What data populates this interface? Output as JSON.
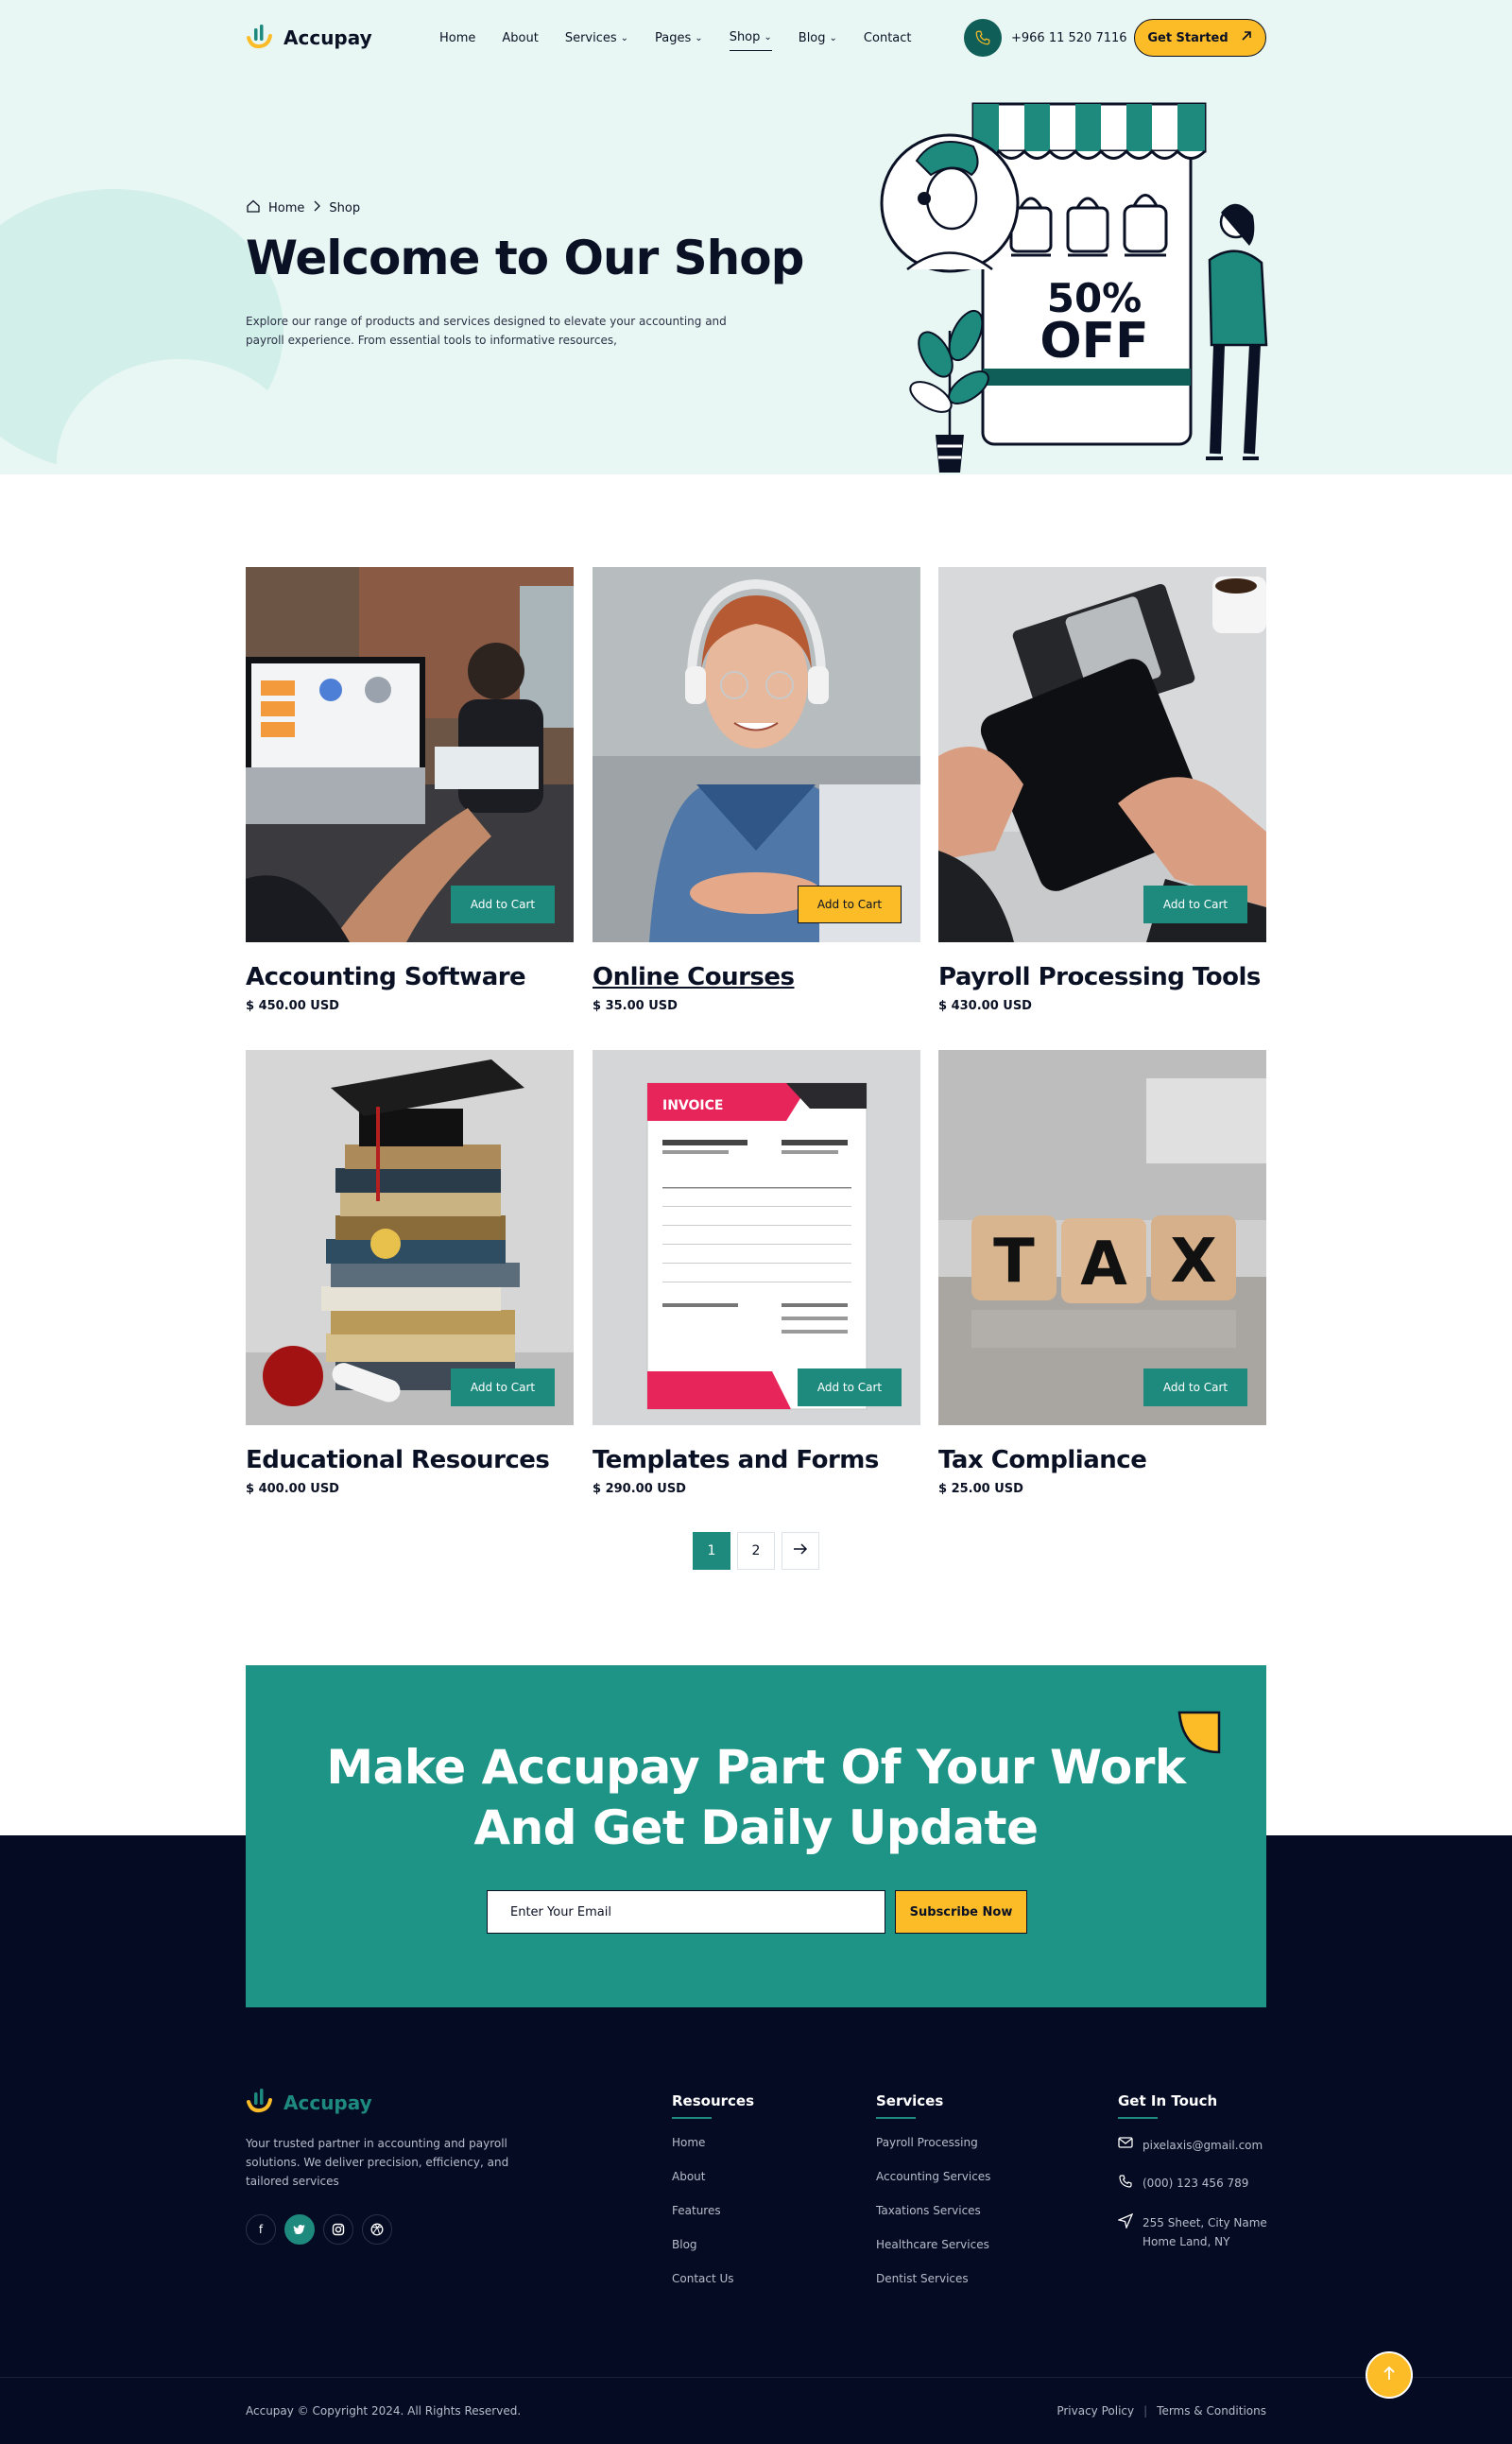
{
  "brand": {
    "name": "Accupay"
  },
  "nav": {
    "items": [
      {
        "label": "Home",
        "dropdown": false
      },
      {
        "label": "About",
        "dropdown": false
      },
      {
        "label": "Services",
        "dropdown": true
      },
      {
        "label": "Pages",
        "dropdown": true
      },
      {
        "label": "Shop",
        "dropdown": true,
        "active": true
      },
      {
        "label": "Blog",
        "dropdown": true
      },
      {
        "label": "Contact",
        "dropdown": false
      }
    ],
    "phone": "+966 11 520 7116",
    "cta_label": "Get Started"
  },
  "hero": {
    "breadcrumb": {
      "home": "Home",
      "current": "Shop"
    },
    "title": "Welcome to Our Shop",
    "description": "Explore our range of products and services designed to elevate your accounting and payroll experience. From essential tools to informative resources,",
    "sale_line1": "50%",
    "sale_line2": "OFF"
  },
  "products": [
    {
      "title": "Accounting Software",
      "price": "$ 450.00 USD",
      "button": "Add to Cart"
    },
    {
      "title": "Online Courses",
      "price": "$ 35.00 USD",
      "button": "Add to Cart"
    },
    {
      "title": "Payroll Processing Tools",
      "price": "$ 430.00 USD",
      "button": "Add to Cart"
    },
    {
      "title": "Educational Resources",
      "price": "$ 400.00 USD",
      "button": "Add to Cart"
    },
    {
      "title": "Templates and Forms",
      "price": "$ 290.00 USD",
      "button": "Add to Cart"
    },
    {
      "title": "Tax Compliance",
      "price": "$ 25.00 USD",
      "button": "Add to Cart"
    }
  ],
  "pagination": {
    "pages": [
      "1",
      "2"
    ],
    "current": "1"
  },
  "invoice_label": "INVOICE",
  "tax_letters": [
    "T",
    "A",
    "X"
  ],
  "cta": {
    "title_line1": "Make Accupay Part Of Your Work",
    "title_line2": "And Get Daily Update",
    "placeholder": "Enter Your Email",
    "button": "Subscribe Now"
  },
  "footer": {
    "about": "Your trusted partner in accounting and payroll solutions. We deliver precision, efficiency, and tailored services",
    "socials": [
      "f",
      "t",
      "i",
      "d"
    ],
    "resources": {
      "title": "Resources",
      "links": [
        "Home",
        "About",
        "Features",
        "Blog",
        "Contact Us"
      ]
    },
    "services": {
      "title": "Services",
      "links": [
        "Payroll Processing",
        "Accounting Services",
        "Taxations Services",
        "Healthcare Services",
        "Dentist Services"
      ]
    },
    "contact": {
      "title": "Get In Touch",
      "email": "pixelaxis@gmail.com",
      "phone": "(000) 123 456 789",
      "address_line1": "255 Sheet, City Name",
      "address_line2": "Home Land, NY"
    },
    "copyright": "Accupay © Copyright 2024. All Rights Reserved.",
    "privacy": "Privacy Policy",
    "terms": "Terms & Conditions"
  },
  "colors": {
    "teal": "#1e8a7e",
    "dark_teal": "#0f5e57",
    "yellow": "#fbbc28",
    "navy": "#050b22",
    "hero_bg": "#e8f7f4"
  }
}
